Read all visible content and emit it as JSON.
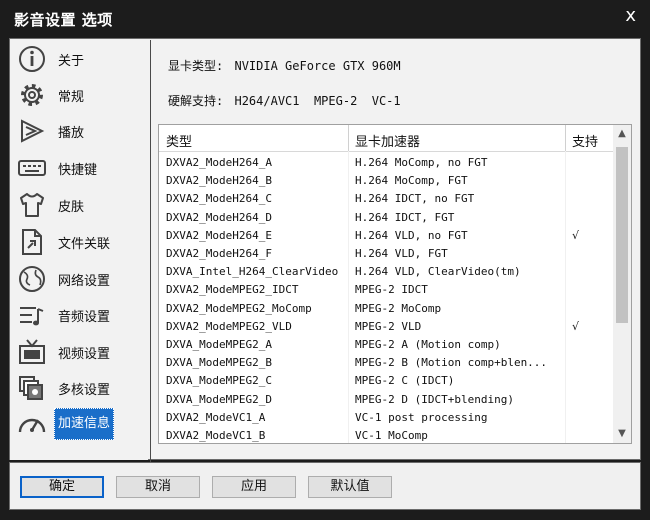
{
  "window": {
    "title": "影音设置 选项",
    "close_glyph": "x"
  },
  "sidebar": {
    "items": [
      {
        "label": "关于",
        "icon": "info-icon"
      },
      {
        "label": "常规",
        "icon": "gear-icon"
      },
      {
        "label": "播放",
        "icon": "play-icon"
      },
      {
        "label": "快捷键",
        "icon": "keyboard-icon"
      },
      {
        "label": "皮肤",
        "icon": "shirt-icon"
      },
      {
        "label": "文件关联",
        "icon": "file-link-icon"
      },
      {
        "label": "网络设置",
        "icon": "globe-icon"
      },
      {
        "label": "音频设置",
        "icon": "audio-icon"
      },
      {
        "label": "视频设置",
        "icon": "tv-icon"
      },
      {
        "label": "多核设置",
        "icon": "multicore-icon"
      },
      {
        "label": "加速信息",
        "icon": "speedometer-icon",
        "active": true
      }
    ]
  },
  "gpu": {
    "type_label": "显卡类型:",
    "type_value": "NVIDIA GeForce GTX 960M",
    "hw_label": "硬解支持:",
    "hw_value": "H264/AVC1  MPEG-2  VC-1"
  },
  "table": {
    "headers": [
      "类型",
      "显卡加速器",
      "支持"
    ],
    "rows": [
      [
        "DXVA2_ModeH264_A",
        "H.264 MoComp, no FGT",
        ""
      ],
      [
        "DXVA2_ModeH264_B",
        "H.264 MoComp, FGT",
        ""
      ],
      [
        "DXVA2_ModeH264_C",
        "H.264 IDCT, no FGT",
        ""
      ],
      [
        "DXVA2_ModeH264_D",
        "H.264 IDCT, FGT",
        ""
      ],
      [
        "DXVA2_ModeH264_E",
        "H.264 VLD, no FGT",
        "√"
      ],
      [
        "DXVA2_ModeH264_F",
        "H.264 VLD, FGT",
        ""
      ],
      [
        "DXVA_Intel_H264_ClearVideo",
        "H.264 VLD, ClearVideo(tm)",
        ""
      ],
      [
        "DXVA2_ModeMPEG2_IDCT",
        "MPEG-2 IDCT",
        ""
      ],
      [
        "DXVA2_ModeMPEG2_MoComp",
        "MPEG-2 MoComp",
        ""
      ],
      [
        "DXVA2_ModeMPEG2_VLD",
        "MPEG-2 VLD",
        "√"
      ],
      [
        "DXVA_ModeMPEG2_A",
        "MPEG-2 A (Motion comp)",
        ""
      ],
      [
        "DXVA_ModeMPEG2_B",
        "MPEG-2 B (Motion comp+blen...",
        ""
      ],
      [
        "DXVA_ModeMPEG2_C",
        "MPEG-2 C (IDCT)",
        ""
      ],
      [
        "DXVA_ModeMPEG2_D",
        "MPEG-2 D (IDCT+blending)",
        ""
      ],
      [
        "DXVA2_ModeVC1_A",
        "VC-1 post processing",
        ""
      ],
      [
        "DXVA2_ModeVC1_B",
        "VC-1 MoComp",
        ""
      ]
    ]
  },
  "buttons": {
    "ok": "确定",
    "cancel": "取消",
    "apply": "应用",
    "default": "默认值"
  },
  "colors": {
    "title_bg": "#1c1c1c",
    "accent": "#1a6ec9",
    "client_bg": "#f2f2f2"
  }
}
